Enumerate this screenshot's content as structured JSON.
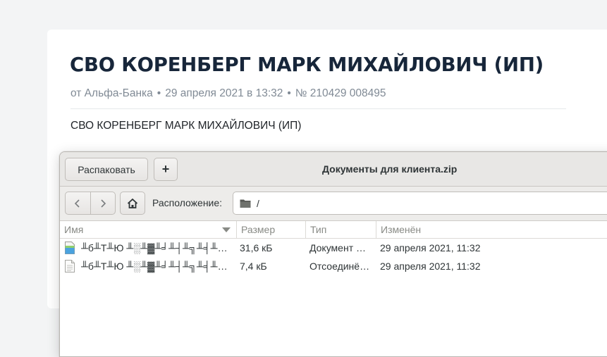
{
  "page": {
    "title": "СВО КОРЕНБЕРГ МАРК МИХАЙЛОВИЧ (ИП)",
    "meta": {
      "source": "от Альфа-Банка",
      "separator": "•",
      "date": "29 апреля 2021 в 13:32",
      "number": "№ 210429 008495"
    },
    "body": "СВО КОРЕНБЕРГ МАРК МИХАЙЛОВИЧ (ИП)"
  },
  "window": {
    "title": "Документы для клиента.zip",
    "toolbar": {
      "extract_label": "Распаковать",
      "add_label": "+"
    },
    "location": {
      "label": "Расположение:",
      "path": "/"
    },
    "columns": {
      "name": "Имя",
      "size": "Размер",
      "type": "Тип",
      "modified": "Изменён"
    },
    "files": [
      {
        "name": "╨б╨Т╨Ю ╨░╨▓╨╛╨┤╨╗╨╡╨╜╨╕╨╡",
        "size": "31,6 кБ",
        "type": "Документ …",
        "modified": "29 апреля 2021, 11:32",
        "icon": "document-icon",
        "icon_color": "#4aa3df"
      },
      {
        "name": "╨б╨Т╨Ю ╨░╨▓╨╛╨┤╨╗╨╡╨╜╨╕╨╡",
        "size": "7,4 кБ",
        "type": "Отсоединё…",
        "modified": "29 апреля 2021, 11:32",
        "icon": "text-file-icon",
        "icon_color": "#d9d9d6"
      }
    ]
  }
}
